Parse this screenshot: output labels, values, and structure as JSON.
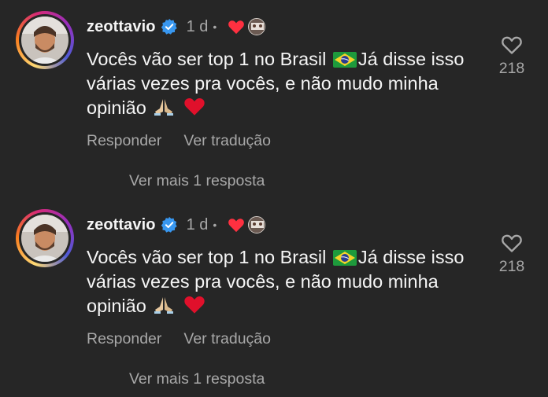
{
  "comments": [
    {
      "username": "zeottavio",
      "time": "1 d",
      "dot": "•",
      "text_a": "Vocês vão ser top 1 no Brasil",
      "text_b": "Já disse isso várias vezes pra vocês, e não mudo minha opinião",
      "reply_label": "Responder",
      "translate_label": "Ver tradução",
      "more_replies": "Ver mais 1 resposta",
      "likes": "218"
    },
    {
      "username": "zeottavio",
      "time": "1 d",
      "dot": "•",
      "text_a": "Vocês vão ser top 1 no Brasil",
      "text_b": "Já disse isso várias vezes pra vocês, e não mudo minha opinião",
      "reply_label": "Responder",
      "translate_label": "Ver tradução",
      "more_replies": "Ver mais 1 resposta",
      "likes": "218"
    }
  ],
  "icons": {
    "verified": "verified-badge-icon",
    "liked_by_author": "red-heart-icon",
    "like": "heart-outline-icon",
    "flag": "brazil-flag-emoji",
    "pray": "folded-hands-emoji",
    "heart_emoji": "red-heart-emoji"
  },
  "colors": {
    "background": "#262626",
    "text": "#f5f5f5",
    "secondary": "#a8a8a8",
    "verified": "#3897f0",
    "heart": "#ff3040"
  }
}
